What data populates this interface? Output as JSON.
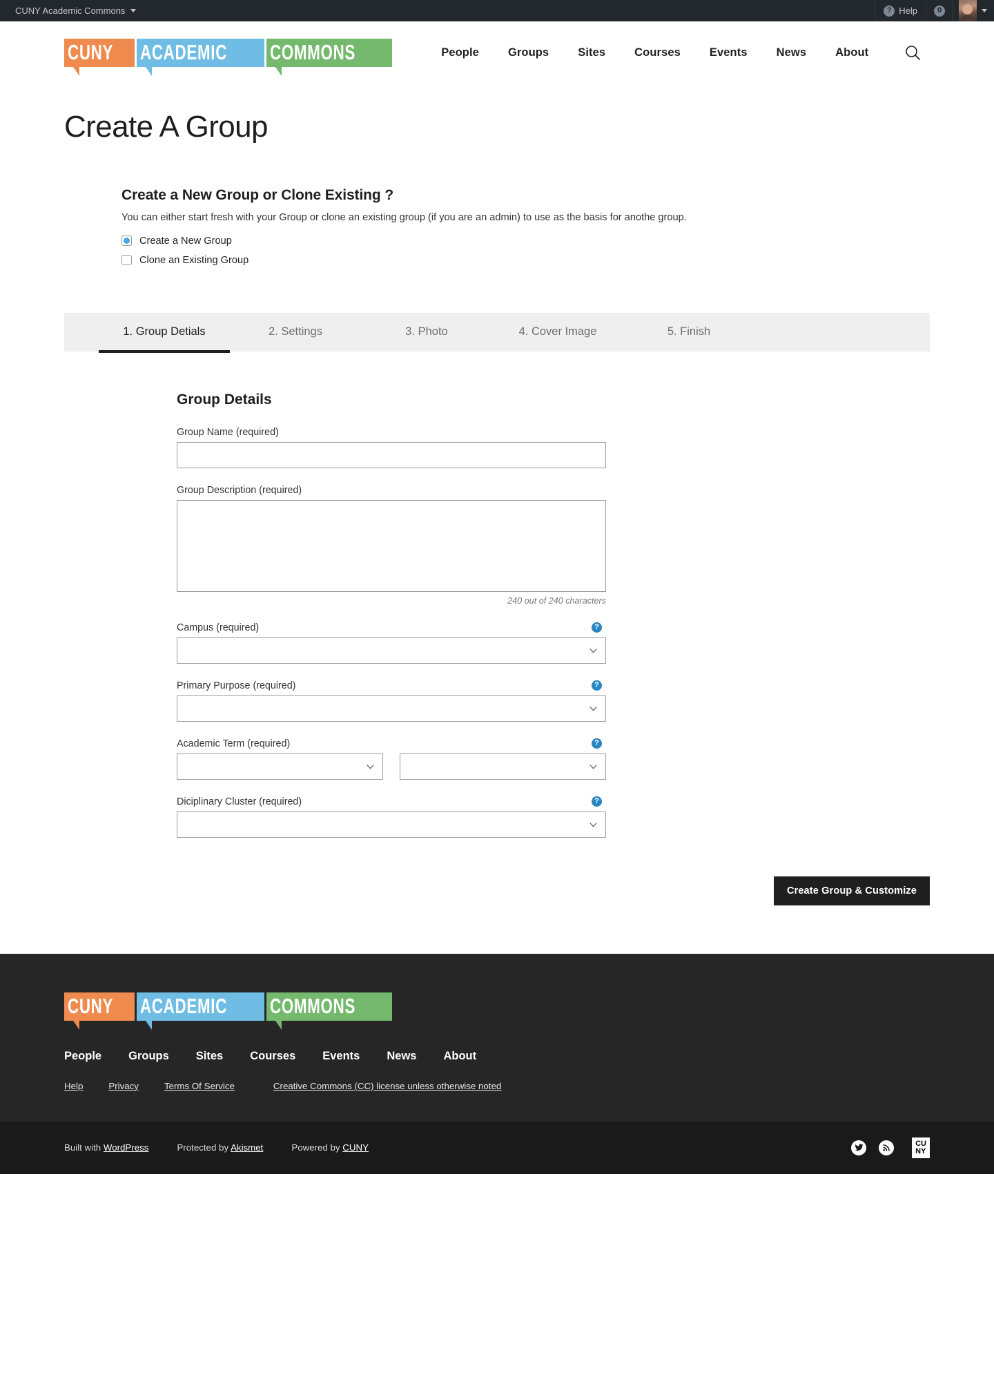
{
  "adminbar": {
    "site_name": "CUNY Academic Commons",
    "help_label": "Help",
    "help_icon": "question-circle-icon",
    "notification_count": "0",
    "avatar_name": "user-avatar"
  },
  "header": {
    "logo": {
      "part1": "CUNY",
      "part2": "ACADEMIC",
      "part3": "COMMONS",
      "color1": "#ef8b4e",
      "color2": "#6fbde4",
      "color3": "#74b96d"
    },
    "nav": [
      {
        "label": "People"
      },
      {
        "label": "Groups"
      },
      {
        "label": "Sites"
      },
      {
        "label": "Courses"
      },
      {
        "label": "Events"
      },
      {
        "label": "News"
      },
      {
        "label": "About"
      }
    ],
    "search_icon": "search-icon"
  },
  "page": {
    "title": "Create A Group"
  },
  "clone_section": {
    "heading": "Create a New Group or Clone Existing ?",
    "description": "You can either start fresh with your Group or clone an existing group (if you are an admin) to use as the basis for anothe group.",
    "options": [
      {
        "label": "Create a New Group",
        "checked": true
      },
      {
        "label": "Clone an Existing Group",
        "checked": false
      }
    ]
  },
  "tabs": [
    {
      "label": "1. Group Detials",
      "active": true
    },
    {
      "label": "2. Settings",
      "active": false
    },
    {
      "label": "3. Photo",
      "active": false
    },
    {
      "label": "4. Cover Image",
      "active": false
    },
    {
      "label": "5. Finish",
      "active": false
    }
  ],
  "form": {
    "title": "Group Details",
    "group_name": {
      "label": "Group Name (required)",
      "value": "",
      "placeholder": ""
    },
    "group_description": {
      "label": "Group Description (required)",
      "value": "",
      "placeholder": ""
    },
    "char_counter": "240 out of 240 characters",
    "campus": {
      "label": "Campus (required)",
      "value": "",
      "help_icon": "help-circle-icon",
      "help_glyph": "?"
    },
    "primary_purpose": {
      "label": "Primary Purpose (required)",
      "value": "",
      "help_icon": "help-circle-icon",
      "help_glyph": "?"
    },
    "academic_term": {
      "label": "Academic Term (required)",
      "value_term": "",
      "value_year": "",
      "help_icon": "help-circle-icon",
      "help_glyph": "?"
    },
    "diciplinary_cluster": {
      "label": "Diciplinary Cluster (required)",
      "value": "",
      "help_icon": "help-circle-icon",
      "help_glyph": "?"
    },
    "submit_label": "Create Group & Customize",
    "chevron_icon": "chevron-down-icon"
  },
  "footer": {
    "logo": {
      "part1": "CUNY",
      "part2": "ACADEMIC",
      "part3": "COMMONS"
    },
    "nav": [
      {
        "label": "People"
      },
      {
        "label": "Groups"
      },
      {
        "label": "Sites"
      },
      {
        "label": "Courses"
      },
      {
        "label": "Events"
      },
      {
        "label": "News"
      },
      {
        "label": "About"
      }
    ],
    "links": [
      {
        "label": "Help"
      },
      {
        "label": "Privacy"
      },
      {
        "label": "Terms Of Service"
      },
      {
        "label": "Creative Commons (CC) license unless otherwise noted"
      }
    ],
    "bottom": {
      "built_with_prefix": "Built with ",
      "built_with_link": "WordPress",
      "protected_prefix": "Protected by ",
      "protected_link": "Akismet",
      "powered_prefix": "Powered by ",
      "powered_link": "CUNY",
      "twitter_icon": "twitter-icon",
      "rss_icon": "rss-icon",
      "cuny_line1": "CU",
      "cuny_line2": "NY"
    }
  }
}
